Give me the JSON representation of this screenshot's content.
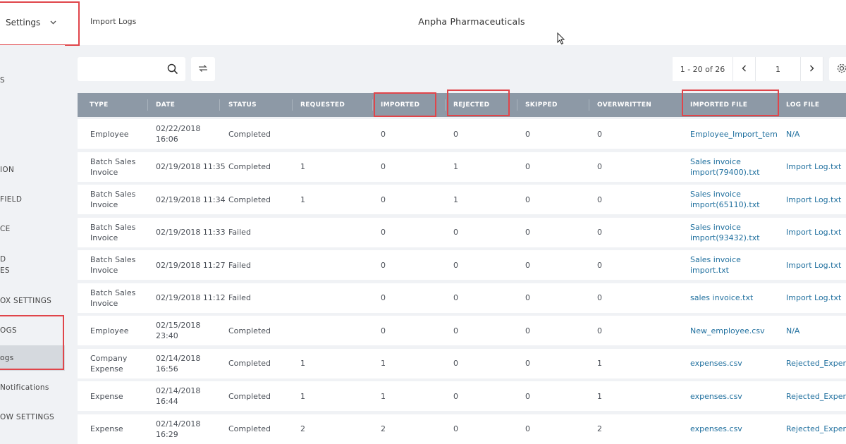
{
  "header": {
    "settings_label": "Settings",
    "breadcrumb": "Import Logs",
    "company": "Anpha Pharmaceuticals"
  },
  "sidebar": {
    "items": [
      {
        "label": "S"
      },
      {
        "label": "ION"
      },
      {
        "label": "FIELD"
      },
      {
        "label": "CE"
      },
      {
        "label": "D"
      },
      {
        "label": "ES"
      },
      {
        "label": "OX SETTINGS"
      },
      {
        "label": "OGS"
      },
      {
        "label": "ogs"
      },
      {
        "label": "Notifications"
      },
      {
        "label": "OW SETTINGS"
      }
    ]
  },
  "toolbar": {
    "search_placeholder": "",
    "page_range": "1 - 20 of 26",
    "page_number": "1"
  },
  "table": {
    "columns": [
      "TYPE",
      "DATE",
      "STATUS",
      "REQUESTED",
      "IMPORTED",
      "REJECTED",
      "SKIPPED",
      "OVERWRITTEN",
      "IMPORTED FILE",
      "LOG FILE"
    ],
    "rows": [
      {
        "type": [
          "Employee"
        ],
        "date": [
          "02/22/2018",
          "16:06"
        ],
        "status": "Completed",
        "requested": "",
        "imported": "0",
        "rejected": "0",
        "skipped": "0",
        "overwritten": "0",
        "file": [
          "Employee_Import_tem"
        ],
        "log": "N/A"
      },
      {
        "type": [
          "Batch Sales",
          "Invoice"
        ],
        "date": [
          "02/19/2018 11:35"
        ],
        "status": "Completed",
        "requested": "1",
        "imported": "0",
        "rejected": "1",
        "skipped": "0",
        "overwritten": "0",
        "file": [
          "Sales invoice",
          "import(79400).txt"
        ],
        "log": "Import Log.txt"
      },
      {
        "type": [
          "Batch Sales",
          "Invoice"
        ],
        "date": [
          "02/19/2018 11:34"
        ],
        "status": "Completed",
        "requested": "1",
        "imported": "0",
        "rejected": "1",
        "skipped": "0",
        "overwritten": "0",
        "file": [
          "Sales invoice",
          "import(65110).txt"
        ],
        "log": "Import Log.txt"
      },
      {
        "type": [
          "Batch Sales",
          "Invoice"
        ],
        "date": [
          "02/19/2018 11:33"
        ],
        "status": "Failed",
        "requested": "",
        "imported": "0",
        "rejected": "0",
        "skipped": "0",
        "overwritten": "0",
        "file": [
          "Sales invoice",
          "import(93432).txt"
        ],
        "log": "Import Log.txt"
      },
      {
        "type": [
          "Batch Sales",
          "Invoice"
        ],
        "date": [
          "02/19/2018 11:27"
        ],
        "status": "Failed",
        "requested": "",
        "imported": "0",
        "rejected": "0",
        "skipped": "0",
        "overwritten": "0",
        "file": [
          "Sales invoice",
          "import.txt"
        ],
        "log": "Import Log.txt"
      },
      {
        "type": [
          "Batch Sales",
          "Invoice"
        ],
        "date": [
          "02/19/2018 11:12"
        ],
        "status": "Failed",
        "requested": "",
        "imported": "0",
        "rejected": "0",
        "skipped": "0",
        "overwritten": "0",
        "file": [
          "sales invoice.txt"
        ],
        "log": "Import Log.txt"
      },
      {
        "type": [
          "Employee"
        ],
        "date": [
          "02/15/2018",
          "23:40"
        ],
        "status": "Completed",
        "requested": "",
        "imported": "0",
        "rejected": "0",
        "skipped": "0",
        "overwritten": "0",
        "file": [
          "New_employee.csv"
        ],
        "log": "N/A"
      },
      {
        "type": [
          "Company",
          "Expense"
        ],
        "date": [
          "02/14/2018",
          "16:56"
        ],
        "status": "Completed",
        "requested": "1",
        "imported": "1",
        "rejected": "0",
        "skipped": "0",
        "overwritten": "1",
        "file": [
          "expenses.csv"
        ],
        "log": "Rejected_Exper"
      },
      {
        "type": [
          "Expense"
        ],
        "date": [
          "02/14/2018",
          "16:44"
        ],
        "status": "Completed",
        "requested": "1",
        "imported": "1",
        "rejected": "0",
        "skipped": "0",
        "overwritten": "1",
        "file": [
          "expenses.csv"
        ],
        "log": "Rejected_Exper"
      },
      {
        "type": [
          "Expense"
        ],
        "date": [
          "02/14/2018",
          "16:29"
        ],
        "status": "Completed",
        "requested": "2",
        "imported": "2",
        "rejected": "0",
        "skipped": "0",
        "overwritten": "2",
        "file": [
          "expenses.csv"
        ],
        "log": "Rejected_Exper"
      }
    ]
  },
  "colors": {
    "header_bg": "#8d99a6",
    "link": "#1f6f9e",
    "highlight_box": "#e0454a",
    "active_sidebar": "#d5d9de"
  }
}
